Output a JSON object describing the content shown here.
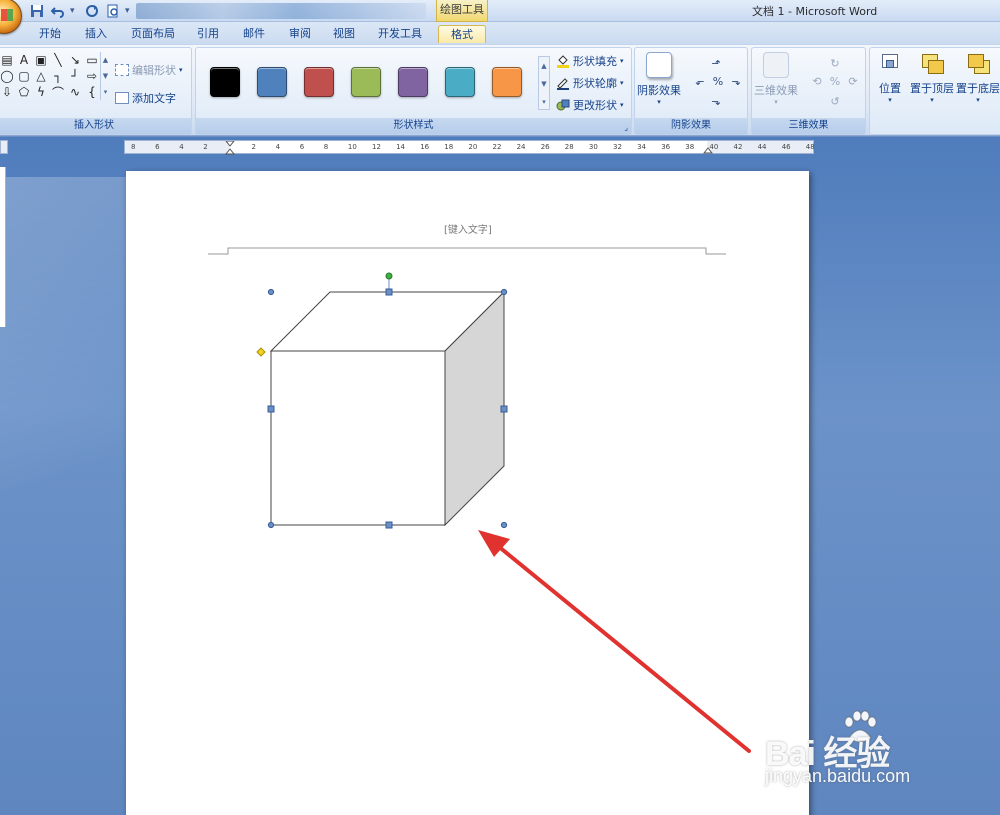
{
  "title_bar": {
    "context_tab_title": "绘图工具",
    "app_title": "文档 1 - Microsoft Word"
  },
  "tabs": [
    {
      "label": "开始"
    },
    {
      "label": "插入"
    },
    {
      "label": "页面布局"
    },
    {
      "label": "引用"
    },
    {
      "label": "邮件"
    },
    {
      "label": "审阅"
    },
    {
      "label": "视图"
    },
    {
      "label": "开发工具"
    },
    {
      "label": "格式",
      "active": true
    }
  ],
  "ribbon": {
    "insert_shapes": {
      "label": "插入形状",
      "edit_shape": "编辑形状",
      "add_text": "添加文字"
    },
    "shape_styles": {
      "label": "形状样式",
      "swatches": [
        "#000000",
        "#4f81bd",
        "#c0504d",
        "#9bbb59",
        "#8064a2",
        "#4bacc6",
        "#f79646"
      ],
      "shape_fill": "形状填充",
      "shape_outline": "形状轮廓",
      "change_shape": "更改形状"
    },
    "shadow_effects": {
      "label": "阴影效果",
      "button": "阴影效果"
    },
    "three_d_effects": {
      "label": "三维效果",
      "button": "三维效果"
    },
    "arrange": {
      "position": "位置",
      "bring_to_front": "置于顶层",
      "send_to_back": "置于底层"
    }
  },
  "ruler": {
    "ticks": [
      "8",
      "6",
      "4",
      "2",
      "",
      "2",
      "4",
      "6",
      "8",
      "10",
      "12",
      "14",
      "16",
      "18",
      "20",
      "22",
      "24",
      "26",
      "28",
      "30",
      "32",
      "34",
      "36",
      "38",
      "40",
      "42",
      "44",
      "46",
      "48"
    ]
  },
  "document": {
    "header_placeholder": "[键入文字]"
  },
  "colors": {
    "cube_side": "#d6d6d6",
    "selection_handle": "#4f81bd",
    "rotation_handle": "#3cb043",
    "adjust_handle": "#f2d31b",
    "arrow": "#e0322f"
  },
  "watermark": {
    "brand": "Bai 经验",
    "url": "jingyan.baidu.com"
  }
}
